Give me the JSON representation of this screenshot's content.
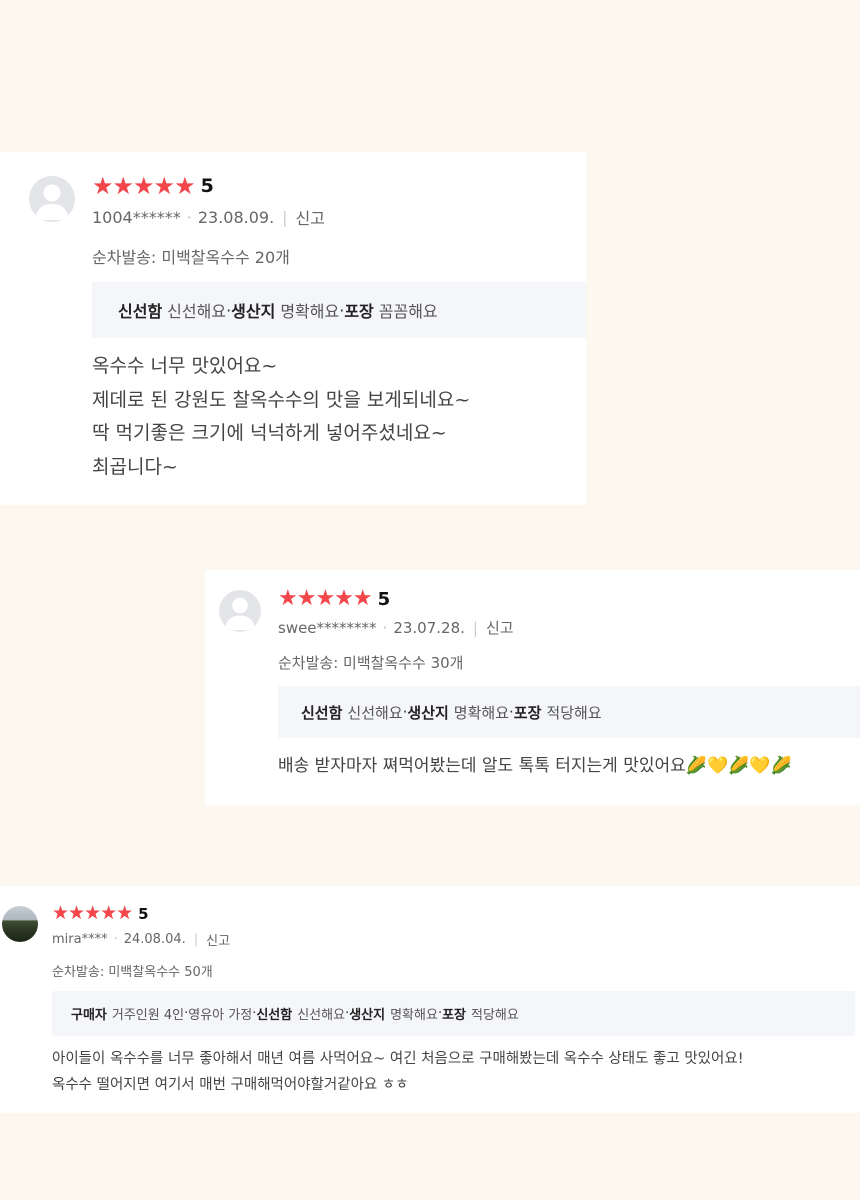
{
  "reviews": [
    {
      "rating": 5,
      "rating_label": "5",
      "stars": "★★★★★",
      "user": "1004******",
      "date": "23.08.09.",
      "report": "신고",
      "option": "순차발송: 미백찰옥수수 20개",
      "tags": [
        {
          "key": "신선함",
          "value": "신선해요"
        },
        {
          "key": "생산지",
          "value": "명확해요"
        },
        {
          "key": "포장",
          "value": "꼼꼼해요"
        }
      ],
      "content": "옥수수  너무 맛있어요~\n제데로 된 강원도 찰옥수수의 맛을 보게되네요~\n 딱 먹기좋은 크기에 넉넉하게 넣어주셨네요~\n최곱니다~"
    },
    {
      "rating": 5,
      "rating_label": "5",
      "stars": "★★★★★",
      "user": "swee********",
      "date": "23.07.28.",
      "report": "신고",
      "option": "순차발송: 미백찰옥수수 30개",
      "tags": [
        {
          "key": "신선함",
          "value": "신선해요"
        },
        {
          "key": "생산지",
          "value": "명확해요"
        },
        {
          "key": "포장",
          "value": "적당해요"
        }
      ],
      "content": "배송 받자마자 쪄먹어봤는데 알도 톡톡 터지는게 맛있어요🌽💛🌽💛🌽"
    },
    {
      "rating": 5,
      "rating_label": "5",
      "stars": "★★★★★",
      "user": "mira****",
      "date": "24.08.04.",
      "report": "신고",
      "option": "순차발송: 미백찰옥수수 50개",
      "tags": [
        {
          "key": "구매자",
          "value": "거주인원 4인"
        },
        {
          "key": "",
          "value": "영유아 가정"
        },
        {
          "key": "신선함",
          "value": "신선해요"
        },
        {
          "key": "생산지",
          "value": "명확해요"
        },
        {
          "key": "포장",
          "value": "적당해요"
        }
      ],
      "content": "아이들이 옥수수를 너무 좋아해서 매년 여름 사먹어요~ 여긴 처음으로 구매해봤는데 옥수수 상태도 좋고 맛있어요!\n옥수수 떨어지면 여기서 매번 구매해먹어야할거같아요 ㅎㅎ"
    }
  ]
}
